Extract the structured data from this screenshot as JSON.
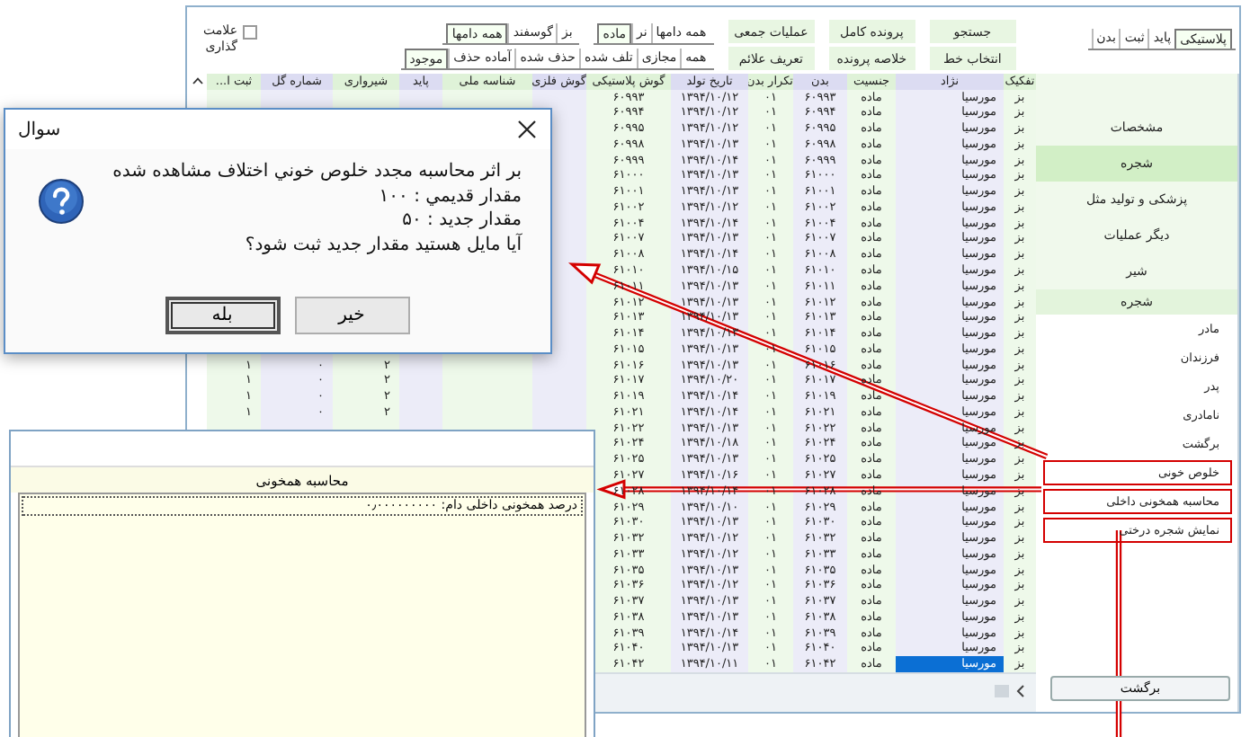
{
  "toolbar": {
    "id_tabs": [
      {
        "label": "پلاستیکی",
        "selected": true
      },
      {
        "label": "پاید",
        "selected": false
      },
      {
        "label": "ثبت",
        "selected": false
      },
      {
        "label": "بدن",
        "selected": false
      }
    ],
    "buttons": [
      {
        "label": "جستجو"
      },
      {
        "label": "انتخاب خط"
      },
      {
        "label": "پرونده کامل"
      },
      {
        "label": "خلاصه پرونده"
      },
      {
        "label": "عملیات جمعی"
      },
      {
        "label": "تعریف علائم"
      }
    ],
    "sex_filter": [
      {
        "label": "همه دامها",
        "selected": false
      },
      {
        "label": "نر",
        "selected": false
      },
      {
        "label": "ماده",
        "selected": true
      }
    ],
    "species_filter": [
      {
        "label": "بز",
        "selected": false
      },
      {
        "label": "گوسفند",
        "selected": false
      },
      {
        "label": "همه دامها",
        "selected": true
      }
    ],
    "status_filter": [
      {
        "label": "همه",
        "selected": false
      },
      {
        "label": "مجازی",
        "selected": false
      },
      {
        "label": "تلف شده",
        "selected": false
      },
      {
        "label": "حذف شده",
        "selected": false
      },
      {
        "label": "آماده حذف",
        "selected": false
      },
      {
        "label": "موجود",
        "selected": true
      }
    ],
    "mark_checkbox": {
      "label": "علامت گذاری",
      "checked": false
    }
  },
  "table": {
    "columns": [
      "تفکیک",
      "نژاد",
      "جنسیت",
      "بدن",
      "تکرار بدن",
      "تاریخ تولد",
      "گوش پلاستیکی",
      "گوش فلزی",
      "شناسه ملی",
      "پاید",
      "شیرواری",
      "شماره گل",
      "ثبت ا..."
    ],
    "rows": [
      {
        "cells": [
          "بز",
          "مورسیا",
          "ماده",
          "۶۰۹۹۳",
          "۰۱",
          "۱۳۹۴/۱۰/۱۲",
          "۶۰۹۹۳"
        ],
        "selected": false
      },
      {
        "cells": [
          "بز",
          "مورسیا",
          "ماده",
          "۶۰۹۹۴",
          "۰۱",
          "۱۳۹۴/۱۰/۱۲",
          "۶۰۹۹۴"
        ],
        "selected": false
      },
      {
        "cells": [
          "بز",
          "مورسیا",
          "ماده",
          "۶۰۹۹۵",
          "۰۱",
          "۱۳۹۴/۱۰/۱۲",
          "۶۰۹۹۵"
        ],
        "selected": false
      },
      {
        "cells": [
          "بز",
          "مورسیا",
          "ماده",
          "۶۰۹۹۸",
          "۰۱",
          "۱۳۹۴/۱۰/۱۳",
          "۶۰۹۹۸"
        ],
        "selected": false
      },
      {
        "cells": [
          "بز",
          "مورسیا",
          "ماده",
          "۶۰۹۹۹",
          "۰۱",
          "۱۳۹۴/۱۰/۱۴",
          "۶۰۹۹۹"
        ],
        "selected": false
      },
      {
        "cells": [
          "بز",
          "مورسیا",
          "ماده",
          "۶۱۰۰۰",
          "۰۱",
          "۱۳۹۴/۱۰/۱۳",
          "۶۱۰۰۰"
        ],
        "selected": false
      },
      {
        "cells": [
          "بز",
          "مورسیا",
          "ماده",
          "۶۱۰۰۱",
          "۰۱",
          "۱۳۹۴/۱۰/۱۳",
          "۶۱۰۰۱"
        ],
        "selected": false
      },
      {
        "cells": [
          "بز",
          "مورسیا",
          "ماده",
          "۶۱۰۰۲",
          "۰۱",
          "۱۳۹۴/۱۰/۱۲",
          "۶۱۰۰۲"
        ],
        "selected": false
      },
      {
        "cells": [
          "بز",
          "مورسیا",
          "ماده",
          "۶۱۰۰۴",
          "۰۱",
          "۱۳۹۴/۱۰/۱۴",
          "۶۱۰۰۴"
        ],
        "selected": false
      },
      {
        "cells": [
          "بز",
          "مورسیا",
          "ماده",
          "۶۱۰۰۷",
          "۰۱",
          "۱۳۹۴/۱۰/۱۳",
          "۶۱۰۰۷"
        ],
        "selected": false
      },
      {
        "cells": [
          "بز",
          "مورسیا",
          "ماده",
          "۶۱۰۰۸",
          "۰۱",
          "۱۳۹۴/۱۰/۱۴",
          "۶۱۰۰۸"
        ],
        "selected": false
      },
      {
        "cells": [
          "بز",
          "مورسیا",
          "ماده",
          "۶۱۰۱۰",
          "۰۱",
          "۱۳۹۴/۱۰/۱۵",
          "۶۱۰۱۰"
        ],
        "selected": false
      },
      {
        "cells": [
          "بز",
          "مورسیا",
          "ماده",
          "۶۱۰۱۱",
          "۰۱",
          "۱۳۹۴/۱۰/۱۳",
          "۶۱۰۱۱"
        ],
        "selected": false
      },
      {
        "cells": [
          "بز",
          "مورسیا",
          "ماده",
          "۶۱۰۱۲",
          "۰۱",
          "۱۳۹۴/۱۰/۱۳",
          "۶۱۰۱۲"
        ],
        "selected": false
      },
      {
        "cells": [
          "بز",
          "مورسیا",
          "ماده",
          "۶۱۰۱۳",
          "۰۱",
          "۱۳۹۴/۱۰/۱۳",
          "۶۱۰۱۳"
        ],
        "selected": false
      },
      {
        "cells": [
          "بز",
          "مورسیا",
          "ماده",
          "۶۱۰۱۴",
          "۰۱",
          "۱۳۹۴/۱۰/۱۳",
          "۶۱۰۱۴"
        ],
        "selected": false
      },
      {
        "cells": [
          "بز",
          "مورسیا",
          "ماده",
          "۶۱۰۱۵",
          "۰۱",
          "۱۳۹۴/۱۰/۱۳",
          "۶۱۰۱۵"
        ],
        "selected": false
      },
      {
        "cells": [
          "بز",
          "مورسیا",
          "ماده",
          "۶۱۰۱۶",
          "۰۱",
          "۱۳۹۴/۱۰/۱۳",
          "۶۱۰۱۶"
        ],
        "trailing_cells": [
          "۲",
          "۰",
          "۱"
        ],
        "selected": false
      },
      {
        "cells": [
          "بز",
          "مورسیا",
          "ماده",
          "۶۱۰۱۷",
          "۰۱",
          "۱۳۹۴/۱۰/۲۰",
          "۶۱۰۱۷"
        ],
        "trailing_cells": [
          "۲",
          "۰",
          "۱"
        ],
        "selected": false
      },
      {
        "cells": [
          "بز",
          "مورسیا",
          "ماده",
          "۶۱۰۱۹",
          "۰۱",
          "۱۳۹۴/۱۰/۱۴",
          "۶۱۰۱۹"
        ],
        "trailing_cells": [
          "۲",
          "۰",
          "۱"
        ],
        "selected": false
      },
      {
        "cells": [
          "بز",
          "مورسیا",
          "ماده",
          "۶۱۰۲۱",
          "۰۱",
          "۱۳۹۴/۱۰/۱۴",
          "۶۱۰۲۱"
        ],
        "trailing_cells": [
          "۲",
          "۰",
          "۱"
        ],
        "selected": false
      },
      {
        "cells": [
          "بز",
          "مورسیا",
          "ماده",
          "۶۱۰۲۲",
          "۰۱",
          "۱۳۹۴/۱۰/۱۳",
          "۶۱۰۲۲"
        ],
        "selected": false
      },
      {
        "cells": [
          "بز",
          "مورسیا",
          "ماده",
          "۶۱۰۲۴",
          "۰۱",
          "۱۳۹۴/۱۰/۱۸",
          "۶۱۰۲۴"
        ],
        "selected": false
      },
      {
        "cells": [
          "بز",
          "مورسیا",
          "ماده",
          "۶۱۰۲۵",
          "۰۱",
          "۱۳۹۴/۱۰/۱۳",
          "۶۱۰۲۵"
        ],
        "selected": false
      },
      {
        "cells": [
          "بز",
          "مورسیا",
          "ماده",
          "۶۱۰۲۷",
          "۰۱",
          "۱۳۹۴/۱۰/۱۶",
          "۶۱۰۲۷"
        ],
        "selected": false
      },
      {
        "cells": [
          "بز",
          "مورسیا",
          "ماده",
          "۶۱۰۲۸",
          "۰۱",
          "۱۳۹۴/۱۰/۱۴",
          "۶۱۰۲۸"
        ],
        "selected": false
      },
      {
        "cells": [
          "بز",
          "مورسیا",
          "ماده",
          "۶۱۰۲۹",
          "۰۱",
          "۱۳۹۴/۱۰/۱۰",
          "۶۱۰۲۹"
        ],
        "selected": false
      },
      {
        "cells": [
          "بز",
          "مورسیا",
          "ماده",
          "۶۱۰۳۰",
          "۰۱",
          "۱۳۹۴/۱۰/۱۳",
          "۶۱۰۳۰"
        ],
        "selected": false
      },
      {
        "cells": [
          "بز",
          "مورسیا",
          "ماده",
          "۶۱۰۳۲",
          "۰۱",
          "۱۳۹۴/۱۰/۱۲",
          "۶۱۰۳۲"
        ],
        "selected": false
      },
      {
        "cells": [
          "بز",
          "مورسیا",
          "ماده",
          "۶۱۰۳۳",
          "۰۱",
          "۱۳۹۴/۱۰/۱۲",
          "۶۱۰۳۳"
        ],
        "selected": false
      },
      {
        "cells": [
          "بز",
          "مورسیا",
          "ماده",
          "۶۱۰۳۵",
          "۰۱",
          "۱۳۹۴/۱۰/۱۳",
          "۶۱۰۳۵"
        ],
        "selected": false
      },
      {
        "cells": [
          "بز",
          "مورسیا",
          "ماده",
          "۶۱۰۳۶",
          "۰۱",
          "۱۳۹۴/۱۰/۱۲",
          "۶۱۰۳۶"
        ],
        "selected": false
      },
      {
        "cells": [
          "بز",
          "مورسیا",
          "ماده",
          "۶۱۰۳۷",
          "۰۱",
          "۱۳۹۴/۱۰/۱۳",
          "۶۱۰۳۷"
        ],
        "selected": false
      },
      {
        "cells": [
          "بز",
          "مورسیا",
          "ماده",
          "۶۱۰۳۸",
          "۰۱",
          "۱۳۹۴/۱۰/۱۳",
          "۶۱۰۳۸"
        ],
        "selected": false
      },
      {
        "cells": [
          "بز",
          "مورسیا",
          "ماده",
          "۶۱۰۳۹",
          "۰۱",
          "۱۳۹۴/۱۰/۱۴",
          "۶۱۰۳۹"
        ],
        "selected": false
      },
      {
        "cells": [
          "بز",
          "مورسیا",
          "ماده",
          "۶۱۰۴۰",
          "۰۱",
          "۱۳۹۴/۱۰/۱۳",
          "۶۱۰۴۰"
        ],
        "selected": false
      },
      {
        "cells": [
          "بز",
          "مورسیا",
          "ماده",
          "۶۱۰۴۲",
          "۰۱",
          "۱۳۹۴/۱۰/۱۱",
          "۶۱۰۴۲"
        ],
        "selected": true
      }
    ]
  },
  "sidebar": {
    "menu": [
      {
        "label": "مشخصات",
        "selected": false
      },
      {
        "label": "شجره",
        "selected": true
      },
      {
        "label": "پزشکی و تولید مثل",
        "selected": false
      },
      {
        "label": "دیگر عملیات",
        "selected": false
      },
      {
        "label": "شیر",
        "selected": false
      }
    ],
    "section_title": "شجره",
    "links": [
      {
        "label": "مادر",
        "highlighted": false
      },
      {
        "label": "فرزندان",
        "highlighted": false
      },
      {
        "label": "پدر",
        "highlighted": false
      },
      {
        "label": "نامادری",
        "highlighted": false
      },
      {
        "label": "برگشت",
        "highlighted": false
      },
      {
        "label": "خلوص خونی",
        "highlighted": true
      },
      {
        "label": "محاسبه همخونی داخلی",
        "highlighted": true
      },
      {
        "label": "نمایش شجره درختی",
        "highlighted": true
      }
    ],
    "back_button": "برگشت"
  },
  "dialog": {
    "title": "سوال",
    "lines": [
      "بر اثر محاسبه مجدد خلوص خوني اختلاف مشاهده شده",
      "مقدار قديمي : ۱۰۰",
      "مقدار جديد : ۵۰",
      "آيا مايل هستيد مقدار جديد ثبت شود؟"
    ],
    "buttons": [
      {
        "label": "خير",
        "focused": false
      },
      {
        "label": "بله",
        "focused": true
      }
    ]
  },
  "kinship_panel": {
    "title": "محاسبه همخونی",
    "lines": [
      "درصد همخونی داخلی دام: ۰٫۰۰۰۰۰۰۰۰۰"
    ]
  }
}
